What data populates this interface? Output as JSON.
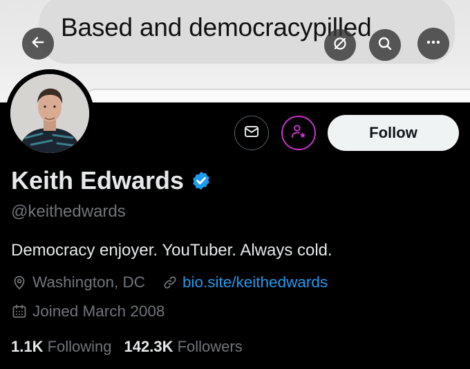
{
  "banner": {
    "text": "Based and democracypilled",
    "background": "#e8e8e8"
  },
  "header": {
    "back_icon": "arrow-left-icon",
    "grok_icon": "grok-icon",
    "search_icon": "search-icon",
    "more_icon": "more-horizontal-icon"
  },
  "actions": {
    "message_icon": "mail-icon",
    "subscribe_icon": "person-star-icon",
    "subscribe_color": "#c936cf",
    "follow_label": "Follow"
  },
  "profile": {
    "name": "Keith Edwards",
    "verified_icon": "verified-badge-icon",
    "verified_color": "#1d9bf0",
    "handle": "@keithedwards",
    "bio": "Democracy enjoyer. YouTuber. Always cold.",
    "location": "Washington, DC",
    "website": "bio.site/keithedwards",
    "joined": "Joined March 2008",
    "following_count": "1.1K",
    "following_label": "Following",
    "followers_count": "142.3K",
    "followers_label": "Followers"
  },
  "colors": {
    "background": "#000000",
    "text_primary": "#e7e9ea",
    "text_secondary": "#71767b",
    "link": "#1d9bf0"
  }
}
